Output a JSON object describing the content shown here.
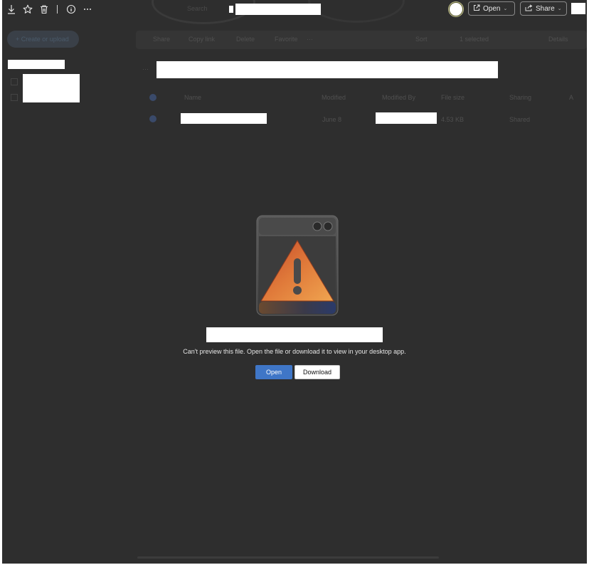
{
  "topbar": {
    "search_placeholder": "Search",
    "open_label": "Open",
    "share_label": "Share",
    "icons": [
      "download-icon",
      "star-icon",
      "trash-icon",
      "info-icon",
      "more-icon"
    ]
  },
  "background": {
    "create_label": "+ Create or upload",
    "commands": [
      "Share",
      "Copy link",
      "Delete",
      "Favorite",
      "···"
    ],
    "sort_label": "Sort",
    "selected_label": "1 selected",
    "details_label": "Details",
    "columns": [
      "Name",
      "Modified",
      "Modified By",
      "File size",
      "Sharing",
      "A"
    ],
    "row": {
      "modified": "June 8",
      "size": "4.53 KB",
      "sharing": "Shared"
    }
  },
  "preview": {
    "message": "Can't preview this file. Open the file or download it to view in your desktop app.",
    "open_button": "Open",
    "download_button": "Download"
  },
  "colors": {
    "app_bg": "#2e2e2e",
    "primary": "#3f76c7"
  }
}
